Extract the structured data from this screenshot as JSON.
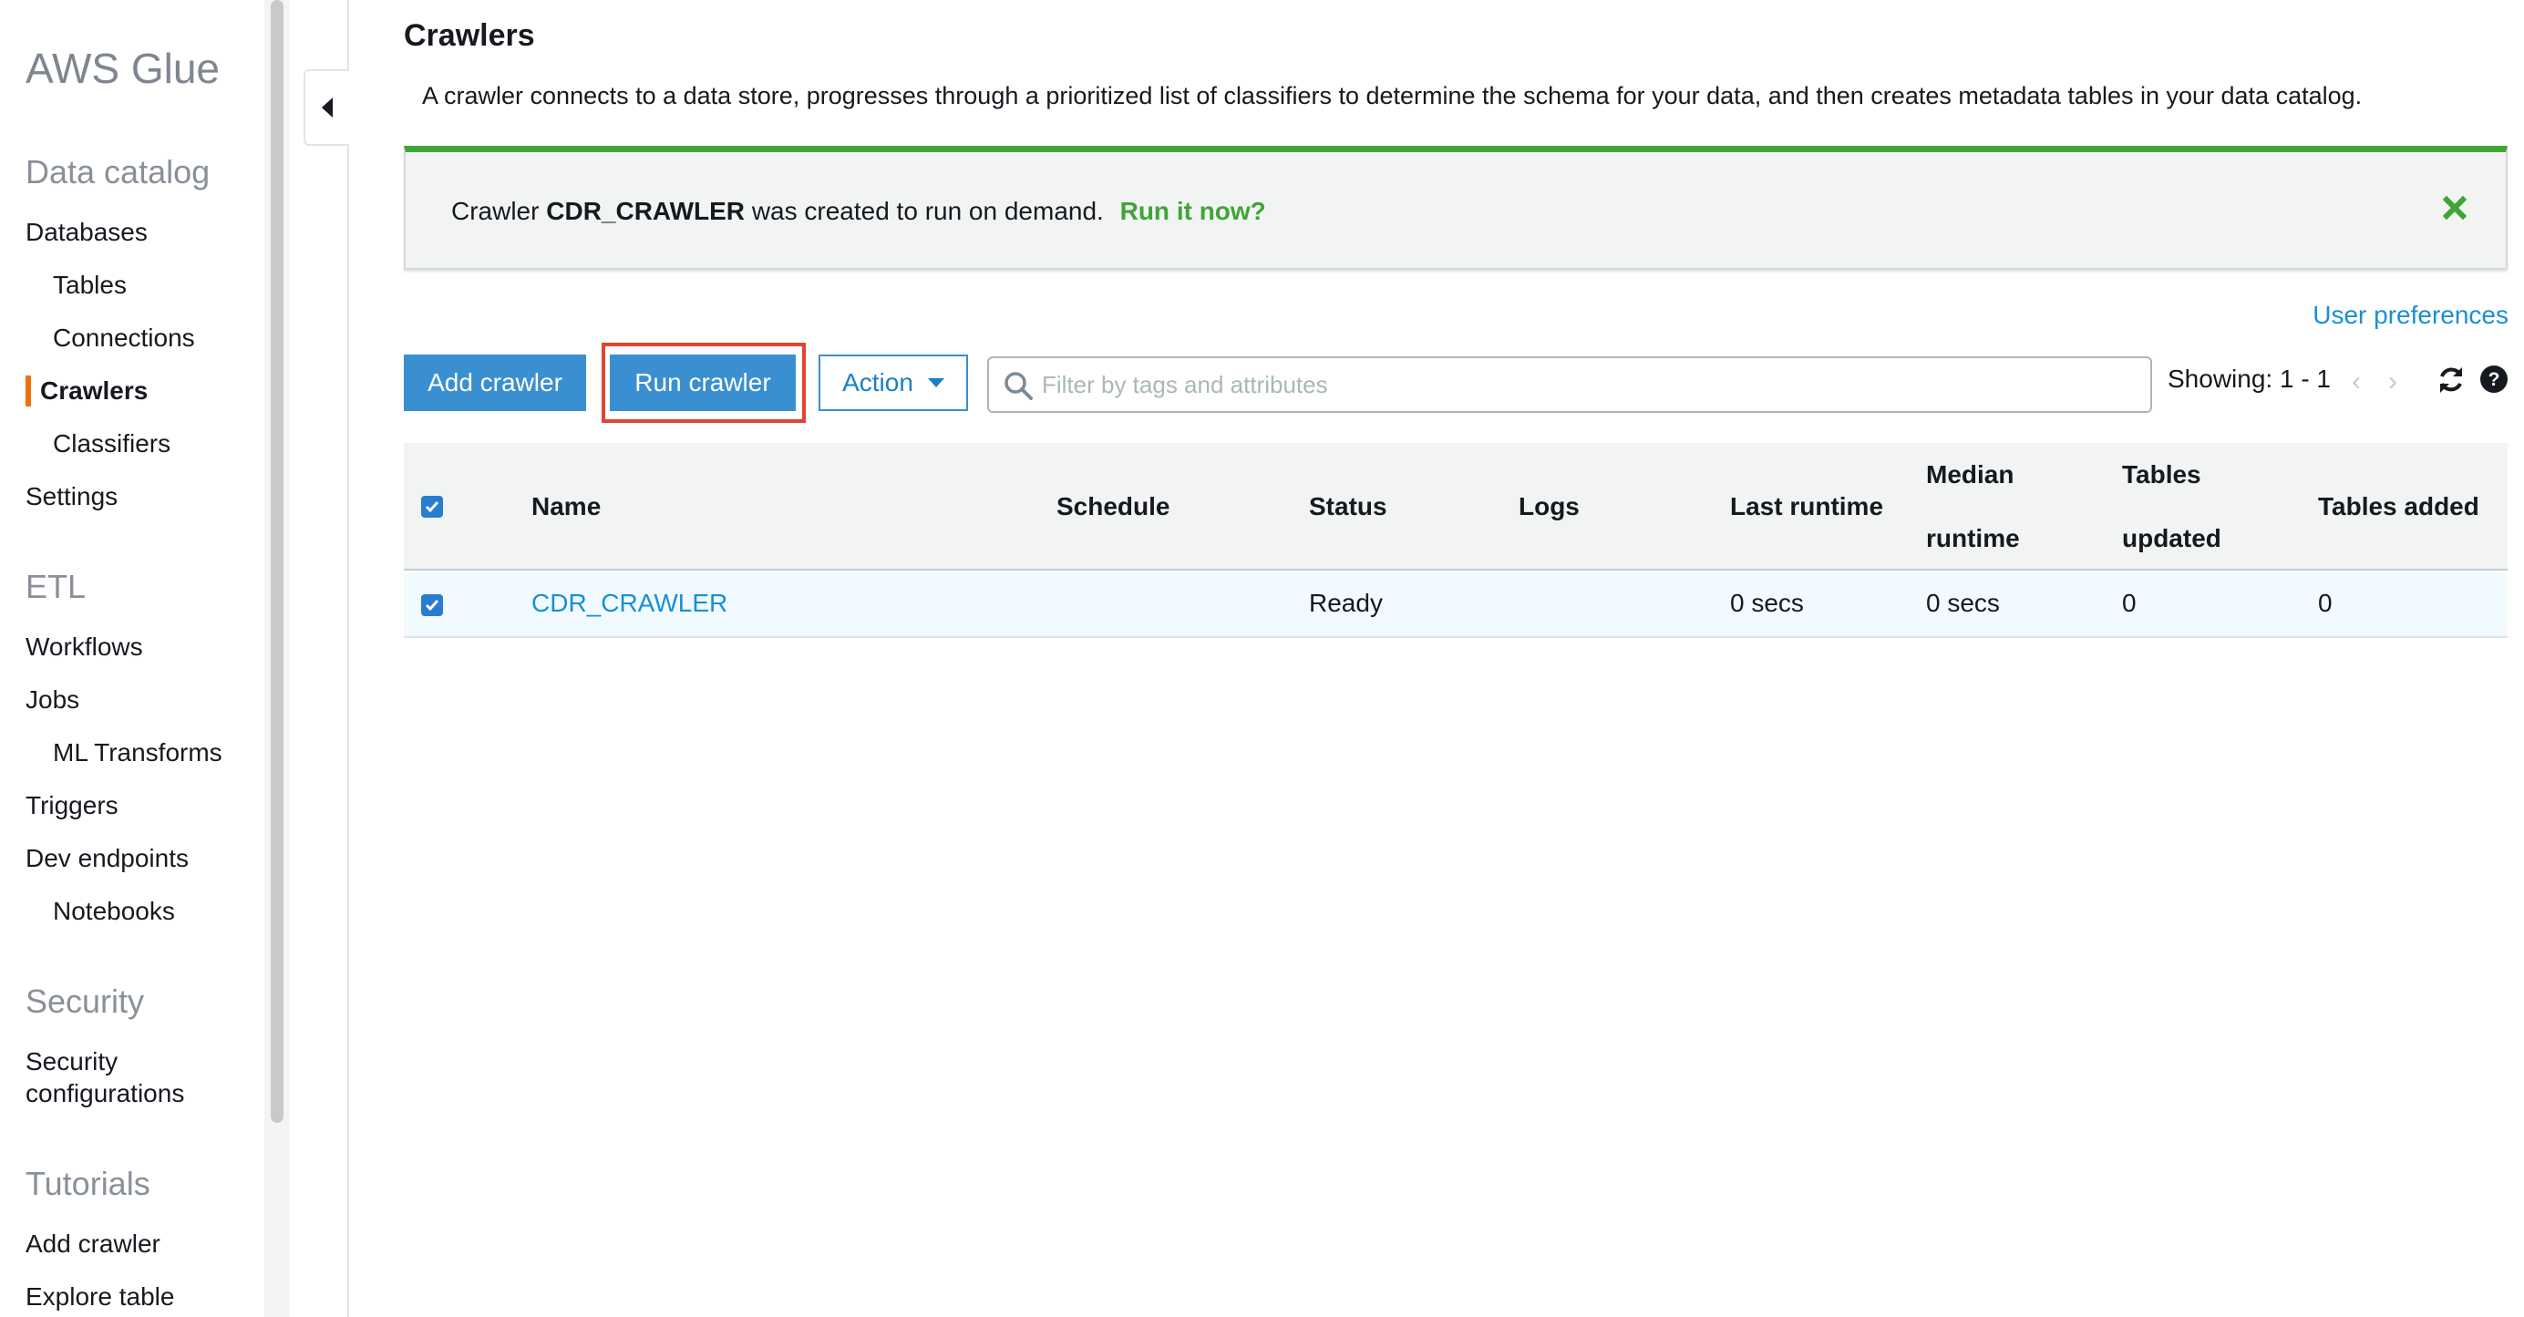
{
  "sidebar": {
    "brand": "AWS Glue",
    "sections": [
      {
        "title": "Data catalog",
        "items": [
          {
            "label": "Databases"
          },
          {
            "label": "Tables"
          },
          {
            "label": "Connections"
          },
          {
            "label": "Crawlers"
          },
          {
            "label": "Classifiers"
          },
          {
            "label": "Settings"
          }
        ]
      },
      {
        "title": "ETL",
        "items": [
          {
            "label": "Workflows"
          },
          {
            "label": "Jobs"
          },
          {
            "label": "ML Transforms"
          },
          {
            "label": "Triggers"
          },
          {
            "label": "Dev endpoints"
          },
          {
            "label": "Notebooks"
          }
        ]
      },
      {
        "title": "Security",
        "items": [
          {
            "label": "Security"
          },
          {
            "label": "configurations"
          }
        ]
      },
      {
        "title": "Tutorials",
        "items": [
          {
            "label": "Add crawler"
          },
          {
            "label": "Explore table"
          }
        ]
      }
    ],
    "active_item": "Crawlers",
    "accent_color": "#ec7211"
  },
  "main": {
    "title": "Crawlers",
    "description": "A crawler connects to a data store, progresses through a prioritized list of classifiers to determine the schema for your data, and then creates metadata tables in your data catalog.",
    "flash": {
      "prefix": "Crawler",
      "crawler_name": "CDR_CRAWLER",
      "suffix": "was created to run on demand.",
      "link": "Run it now?",
      "color": "#3fa535"
    },
    "user_preferences": "User preferences",
    "toolbar": {
      "add_crawler": "Add crawler",
      "run_crawler": "Run crawler",
      "action": "Action",
      "filter_placeholder": "Filter by tags and attributes",
      "showing": "Showing: 1 - 1"
    },
    "table": {
      "headers": {
        "name": "Name",
        "schedule": "Schedule",
        "status": "Status",
        "logs": "Logs",
        "last_runtime": "Last runtime",
        "median_runtime_1": "Median",
        "median_runtime_2": "runtime",
        "tables_updated_1": "Tables",
        "tables_updated_2": "updated",
        "tables_added": "Tables added"
      },
      "rows": [
        {
          "name": "CDR_CRAWLER",
          "schedule": "",
          "status": "Ready",
          "logs": "",
          "last_runtime": "0 secs",
          "median_runtime": "0 secs",
          "tables_updated": "0",
          "tables_added": "0"
        }
      ]
    }
  }
}
